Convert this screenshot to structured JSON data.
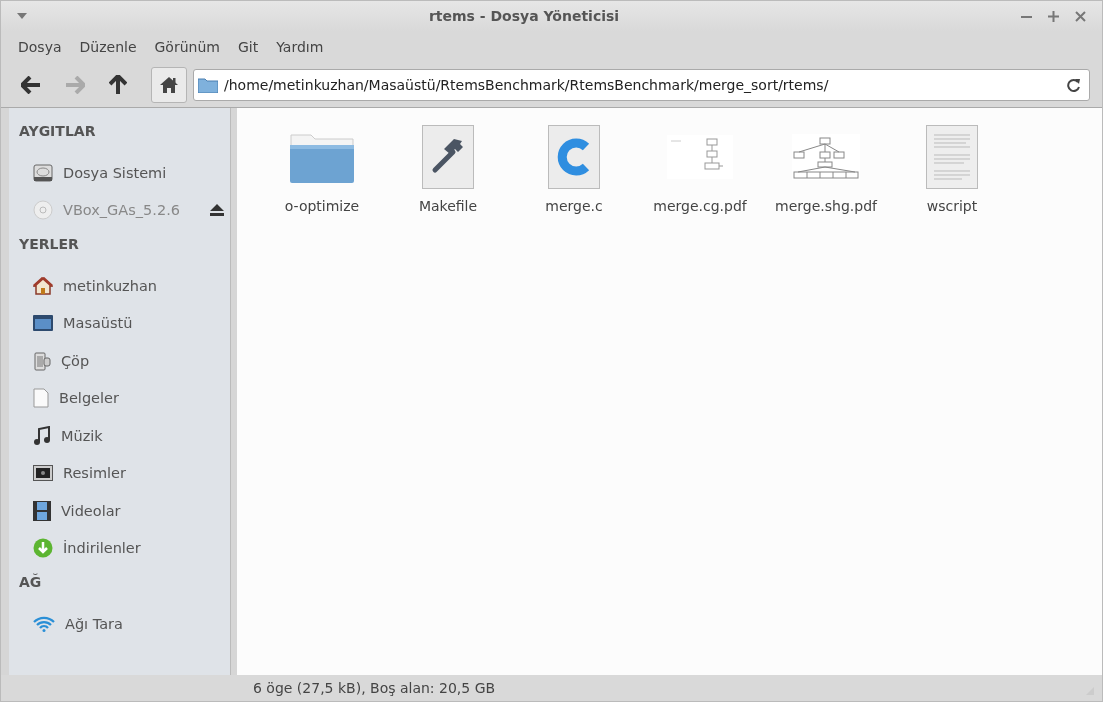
{
  "window": {
    "title": "rtems - Dosya Yöneticisi"
  },
  "menu": [
    "Dosya",
    "Düzenle",
    "Görünüm",
    "Git",
    "Yardım"
  ],
  "toolbar": {
    "back_disabled": false,
    "forward_disabled": true,
    "up_disabled": false,
    "home_pressed": true
  },
  "location": {
    "value": "/home/metinkuzhan/Masaüstü/RtemsBenchmark/RtemsBenchmark/merge_sort/rtems/"
  },
  "sidebar": {
    "sections": [
      {
        "title": "AYGITLAR",
        "items": [
          {
            "label": "Dosya Sistemi",
            "kind": "drive",
            "mounted": true,
            "ejectable": false
          },
          {
            "label": "VBox_GAs_5.2.6",
            "kind": "disc",
            "mounted": false,
            "ejectable": true
          }
        ]
      },
      {
        "title": "YERLER",
        "items": [
          {
            "label": "metinkuzhan",
            "kind": "home",
            "mounted": true,
            "ejectable": false
          },
          {
            "label": "Masaüstü",
            "kind": "desktop",
            "mounted": true,
            "ejectable": false
          },
          {
            "label": "Çöp",
            "kind": "trash",
            "mounted": true,
            "ejectable": false
          },
          {
            "label": "Belgeler",
            "kind": "document",
            "mounted": true,
            "ejectable": false
          },
          {
            "label": "Müzik",
            "kind": "music",
            "mounted": true,
            "ejectable": false
          },
          {
            "label": "Resimler",
            "kind": "pictures",
            "mounted": true,
            "ejectable": false
          },
          {
            "label": "Videolar",
            "kind": "video",
            "mounted": true,
            "ejectable": false
          },
          {
            "label": "İndirilenler",
            "kind": "download",
            "mounted": true,
            "ejectable": false
          }
        ]
      },
      {
        "title": "AĞ",
        "items": [
          {
            "label": "Ağı Tara",
            "kind": "network",
            "mounted": true,
            "ejectable": false
          }
        ]
      }
    ]
  },
  "files": [
    {
      "name": "o-optimize",
      "kind": "folder"
    },
    {
      "name": "Makefile",
      "kind": "makefile"
    },
    {
      "name": "merge.c",
      "kind": "c-source"
    },
    {
      "name": "merge.cg.pdf",
      "kind": "graph-small"
    },
    {
      "name": "merge.shg.pdf",
      "kind": "graph-tree"
    },
    {
      "name": "wscript",
      "kind": "text"
    }
  ],
  "status_bar": "6 öge (27,5 kB), Boş alan: 20,5 GB"
}
